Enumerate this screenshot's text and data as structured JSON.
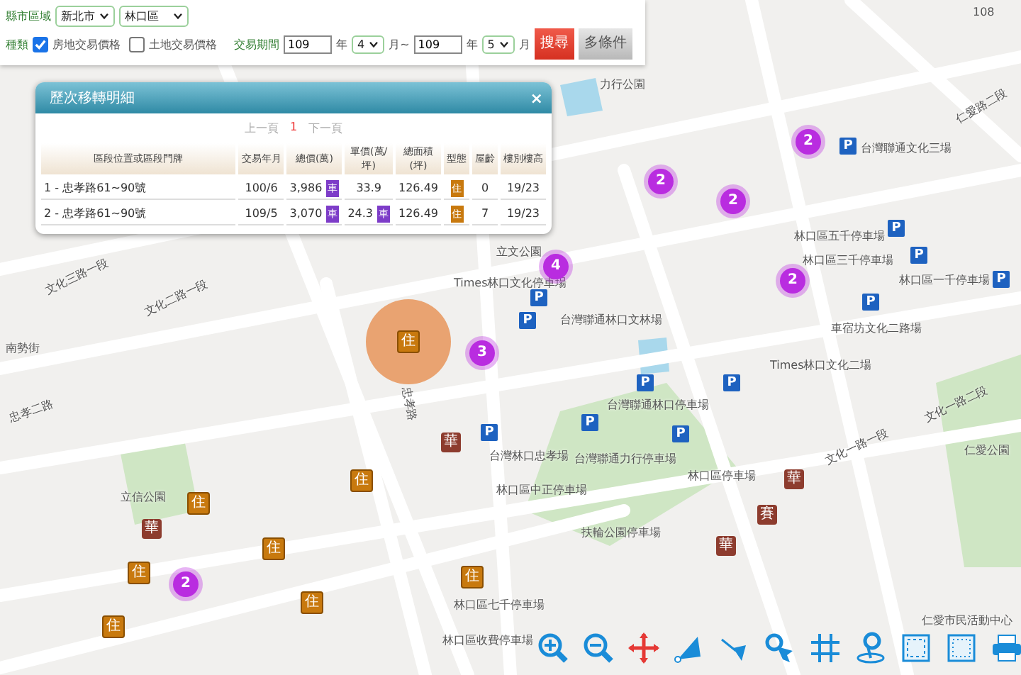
{
  "filter": {
    "region_label": "縣市區域",
    "city": "新北市",
    "district": "林口區",
    "type_label": "種類",
    "types": [
      {
        "label": "房地交易價格",
        "checked": true
      },
      {
        "label": "土地交易價格",
        "checked": false
      }
    ],
    "period_label": "交易期間",
    "from_year": "109",
    "year_unit_1": "年",
    "from_month": "4",
    "range_sep": "月~",
    "to_year": "109",
    "year_unit_2": "年",
    "to_month": "5",
    "month_unit": "月",
    "buttons": [
      {
        "kind": "primary",
        "label": "搜尋"
      },
      {
        "kind": "secondary",
        "label": "多條件"
      }
    ]
  },
  "popup": {
    "title": "歷次移轉明細",
    "close": "×",
    "pager": {
      "prev": "上一頁",
      "current": "1",
      "next": "下一頁"
    },
    "columns": [
      "區段位置或區段門牌",
      "交易年月",
      "總價(萬)",
      "單價(萬/坪)",
      "總面積(坪)",
      "型態",
      "屋齡",
      "樓別樓高"
    ],
    "rows": [
      {
        "address": "1 - 忠孝路61~90號",
        "date": "100/6",
        "total": "3,986",
        "total_badge": "車",
        "unit": "33.9",
        "area": "126.49",
        "type": "住",
        "age": "0",
        "floor": "19/23"
      },
      {
        "address": "2 - 忠孝路61~90號",
        "date": "109/5",
        "total": "3,070",
        "total_badge": "車",
        "unit": "24.3",
        "unit_badge": "車",
        "area": "126.49",
        "type": "住",
        "age": "7",
        "floor": "19/23"
      }
    ]
  },
  "map": {
    "labels": [
      "108",
      "力行公園",
      "仁愛路二段",
      "台灣聯通文化三場",
      "林口區五千停車場",
      "立文公園",
      "林口區三千停車場",
      "Times林口文化停車場",
      "林口區一千停車場",
      "文化三路一段",
      "文化二路一段",
      "台灣聯通林口文林場",
      "車宿坊文化二路場",
      "南勢街",
      "Times林口文化二場",
      "忠孝路",
      "台灣聯通林口停車場",
      "文化一路二段",
      "忠孝二路",
      "仁愛公園",
      "台灣林口忠孝場",
      "台灣聯通力行停車場",
      "文化一路一段",
      "林口區停車場",
      "林口區中正停車場",
      "立信公園",
      "扶輪公園停車場",
      "林口區七千停車場",
      "仁愛市民活動中心",
      "林口區收費停車場"
    ],
    "markers": [
      {
        "kind": "selected",
        "label": "住"
      },
      {
        "kind": "house",
        "label": "住"
      },
      {
        "kind": "house",
        "label": "住"
      },
      {
        "kind": "house",
        "label": "住"
      },
      {
        "kind": "house",
        "label": "住"
      },
      {
        "kind": "house",
        "label": "住"
      },
      {
        "kind": "house",
        "label": "住"
      },
      {
        "kind": "house",
        "label": "住"
      },
      {
        "kind": "building",
        "label": "華"
      },
      {
        "kind": "building",
        "label": "華"
      },
      {
        "kind": "building",
        "label": "華"
      },
      {
        "kind": "building",
        "label": "華"
      },
      {
        "kind": "building",
        "label": "賽"
      },
      {
        "kind": "cluster",
        "label": "2"
      },
      {
        "kind": "cluster",
        "label": "2"
      },
      {
        "kind": "cluster",
        "label": "2"
      },
      {
        "kind": "cluster",
        "label": "2"
      },
      {
        "kind": "cluster",
        "label": "4"
      },
      {
        "kind": "cluster",
        "label": "3"
      },
      {
        "kind": "cluster",
        "label": "2"
      },
      {
        "kind": "parking",
        "label": "P"
      },
      {
        "kind": "parking",
        "label": "P"
      },
      {
        "kind": "parking",
        "label": "P"
      },
      {
        "kind": "parking",
        "label": "P"
      },
      {
        "kind": "parking",
        "label": "P"
      },
      {
        "kind": "parking",
        "label": "P"
      },
      {
        "kind": "parking",
        "label": "P"
      },
      {
        "kind": "parking",
        "label": "P"
      },
      {
        "kind": "parking",
        "label": "P"
      },
      {
        "kind": "parking",
        "label": "P"
      },
      {
        "kind": "parking",
        "label": "P"
      },
      {
        "kind": "parking",
        "label": "P"
      }
    ]
  }
}
